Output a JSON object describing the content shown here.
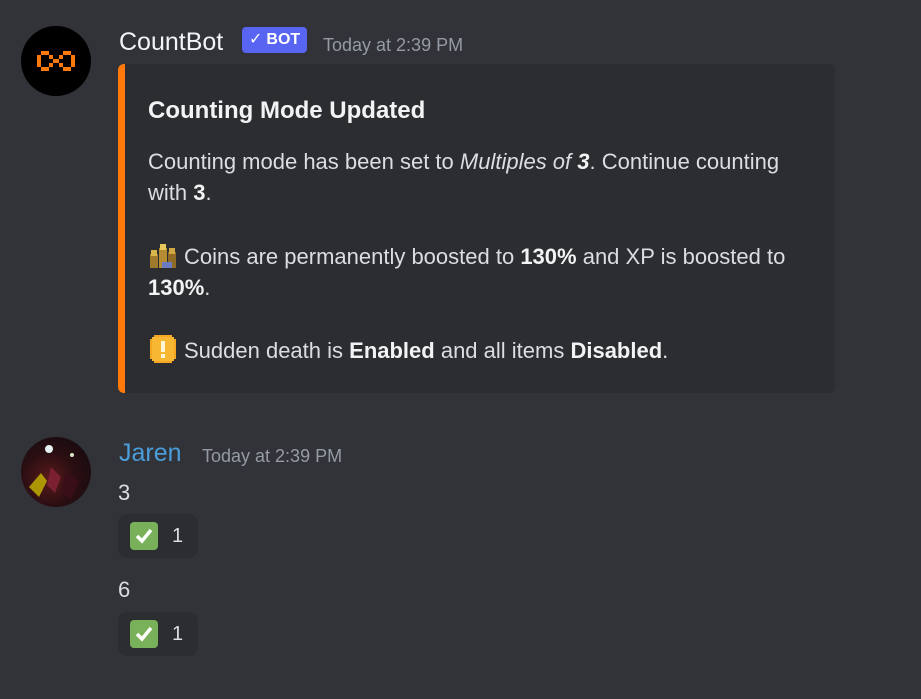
{
  "colors": {
    "background": "#313338",
    "embed_accent": "#ff7a0a",
    "bot_tag": "#5865f2",
    "username_user": "#4a9edb",
    "reaction_check": "#78b159"
  },
  "messages": [
    {
      "author": "CountBot",
      "bot_tag": "BOT",
      "bot_check": "✓",
      "timestamp": "Today at 2:39 PM",
      "avatar_icon": "infinity-logo-icon",
      "embed": {
        "title": "Counting Mode Updated",
        "p1": {
          "a": "Counting mode has been set to ",
          "mode": "Multiples of ",
          "mode_num": "3",
          "b": ". Continue counting with ",
          "next": "3",
          "c": "."
        },
        "p2": {
          "emoji": "coins-icon",
          "a": "Coins are permanently boosted to ",
          "coins": "130%",
          "b": " and XP is boosted to ",
          "xp": "130%",
          "c": "."
        },
        "p3": {
          "emoji": "warning-icon",
          "a": "Sudden death is ",
          "state": "Enabled",
          "b": " and all items ",
          "items": "Disabled",
          "c": "."
        }
      }
    },
    {
      "author": "Jaren",
      "timestamp": "Today at 2:39 PM",
      "avatar_icon": "user-avatar",
      "lines": [
        {
          "text": "3",
          "reaction": {
            "emoji": "white-check-mark-icon",
            "count": "1"
          }
        },
        {
          "text": "6",
          "reaction": {
            "emoji": "white-check-mark-icon",
            "count": "1"
          }
        }
      ]
    }
  ]
}
